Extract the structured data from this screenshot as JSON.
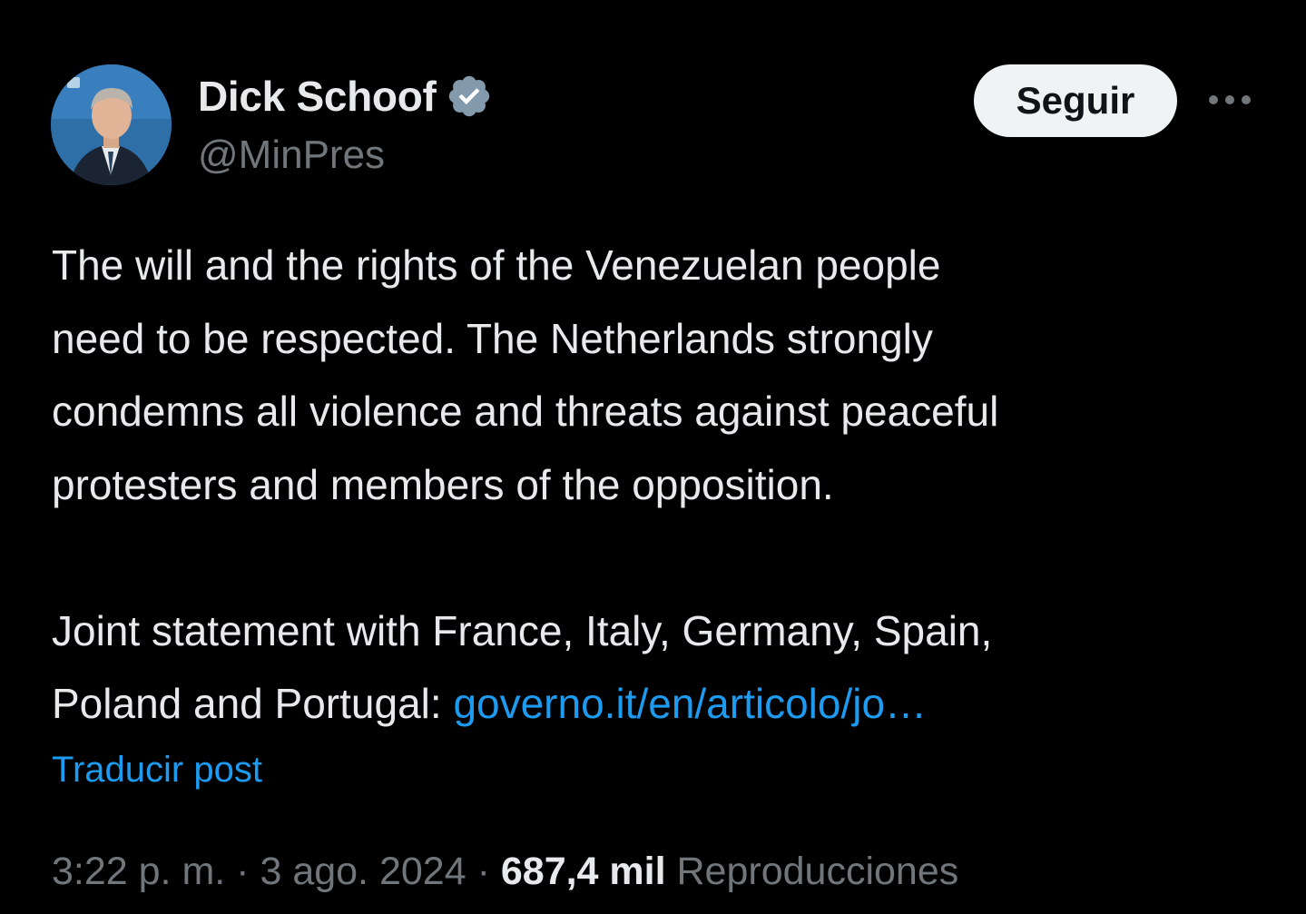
{
  "post": {
    "author": {
      "name": "Dick Schoof",
      "handle": "@MinPres",
      "verified_icon": "verified-badge-icon",
      "avatar_icon": "profile-photo"
    },
    "follow_label": "Seguir",
    "more_icon": "more-dots-icon",
    "text_lines": [
      "The will and the rights of the Venezuelan people",
      "need to be respected. The Netherlands strongly",
      "condemns all violence and threats against peaceful",
      "protesters and members of the opposition."
    ],
    "statement_line_1": "Joint statement with France, Italy, Germany, Spain,",
    "statement_line_2_prefix": "Poland and Portugal: ",
    "link_text": "governo.it/en/articolo/jo…",
    "translate_label": "Traducir post",
    "time": "3:22 p. m.",
    "separator": "·",
    "date": "3 ago. 2024",
    "views_count": "687,4 mil",
    "views_label": "Reproducciones"
  },
  "colors": {
    "background": "#000000",
    "text": "#e7e9ea",
    "secondary": "#71767b",
    "link": "#1d9bf0",
    "verified": "#829aab",
    "button_bg": "#eff3f4"
  }
}
